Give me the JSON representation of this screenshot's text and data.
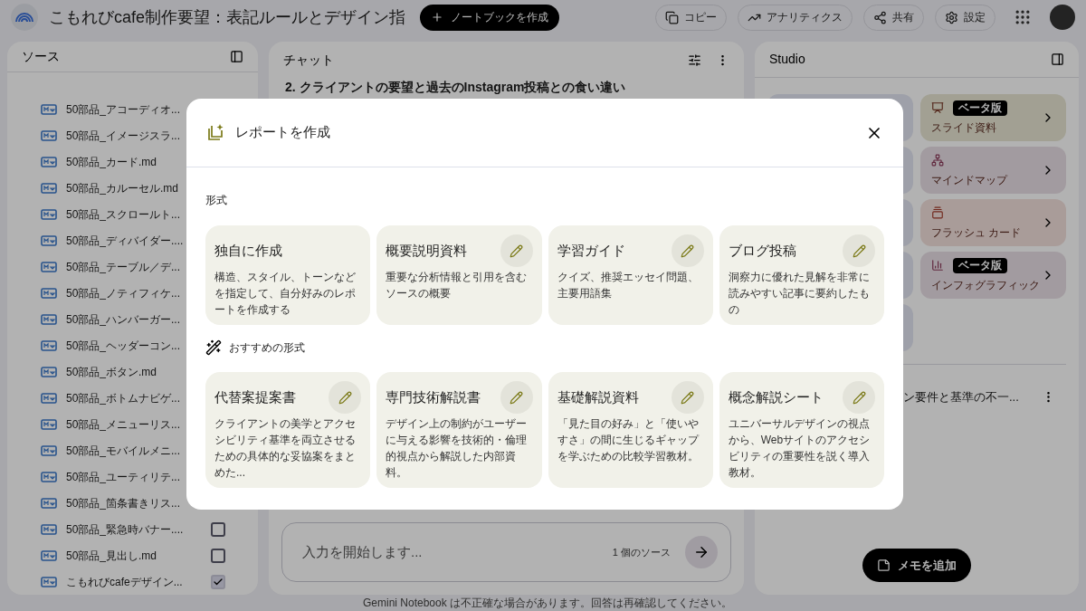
{
  "header": {
    "title": "こもれびcafe制作要望：表記ルールとデザイン指",
    "create_button": "ノートブックを作成",
    "actions": [
      {
        "kind": "copy",
        "label": "コピー"
      },
      {
        "kind": "analytics",
        "label": "アナリティクス"
      },
      {
        "kind": "share",
        "label": "共有"
      },
      {
        "kind": "settings",
        "label": "設定"
      }
    ]
  },
  "sources": {
    "title": "ソース",
    "items": [
      {
        "name": "50部品_アコーディオ..."
      },
      {
        "name": "50部品_イメージスラ..."
      },
      {
        "name": "50部品_カード.md"
      },
      {
        "name": "50部品_カルーセル.md"
      },
      {
        "name": "50部品_スクロールト..."
      },
      {
        "name": "50部品_ディバイダー...."
      },
      {
        "name": "50部品_テーブル／デ..."
      },
      {
        "name": "50部品_ノティフィケ..."
      },
      {
        "name": "50部品_ハンバーガー..."
      },
      {
        "name": "50部品_ヘッダーコン..."
      },
      {
        "name": "50部品_ボタン.md"
      },
      {
        "name": "50部品_ボトムナビゲ..."
      },
      {
        "name": "50部品_メニューリス..."
      },
      {
        "name": "50部品_モバイルメニ..."
      },
      {
        "name": "50部品_ユーティリテ..."
      },
      {
        "name": "50部品_箇条書きリス..."
      },
      {
        "name": "50部品_緊急時バナー....",
        "checked": false
      },
      {
        "name": "50部品_見出し.md",
        "checked": false
      },
      {
        "name": "こもれびcafeデザイン...",
        "checked": true
      }
    ]
  },
  "chat": {
    "title": "チャット",
    "heading": "2. クライアントの要望と過去のInstagram投稿との食い違い",
    "input_placeholder": "入力を開始します...",
    "source_count": "1 個のソース",
    "disclaimer": "Gemini Notebook は不正確な場合があります。回答は再確認してください。"
  },
  "studio": {
    "title": "Studio",
    "tiles": [
      {
        "kind": "slides",
        "label": "スライド資料",
        "badge": "ベータ版"
      },
      {
        "kind": "mindmap",
        "label": "マインドマップ"
      },
      {
        "kind": "flashcards",
        "label": "フラッシュ カード"
      },
      {
        "kind": "infographic",
        "label": "インフォグラフィック",
        "badge": "ベータ版"
      }
    ],
    "note": "ン要件と基準の不一...",
    "add_note": "メモを追加"
  },
  "dialog": {
    "title": "レポートを作成",
    "section": "形式",
    "formats": [
      {
        "title": "独自に作成",
        "description": "構造、スタイル、トーンなどを指定して、自分好みのレポートを作成する",
        "editable": false
      },
      {
        "title": "概要説明資料",
        "description": "重要な分析情報と引用を含むソースの概要",
        "editable": true
      },
      {
        "title": "学習ガイド",
        "description": "クイズ、推奨エッセイ問題、主要用語集",
        "editable": true
      },
      {
        "title": "ブログ投稿",
        "description": "洞察力に優れた見解を非常に読みやすい記事に要約したもの",
        "editable": true
      }
    ],
    "suggested_section": "おすすめの形式",
    "suggested": [
      {
        "title": "代替案提案書",
        "description": "クライアントの美学とアクセシビリティ基準を両立させるための具体的な妥協案をまとめた...",
        "editable": true
      },
      {
        "title": "専門技術解説書",
        "description": "デザイン上の制約がユーザーに与える影響を技術的・倫理的視点から解説した内部資料。",
        "editable": true
      },
      {
        "title": "基礎解説資料",
        "description": "「見た目の好み」と「使いやすさ」の間に生じるギャップを学ぶための比較学習教材。",
        "editable": true
      },
      {
        "title": "概念解説シート",
        "description": "ユニバーサルデザインの視点から、Webサイトのアクセシビリティの重要性を説く導入教材。",
        "editable": true
      }
    ]
  }
}
